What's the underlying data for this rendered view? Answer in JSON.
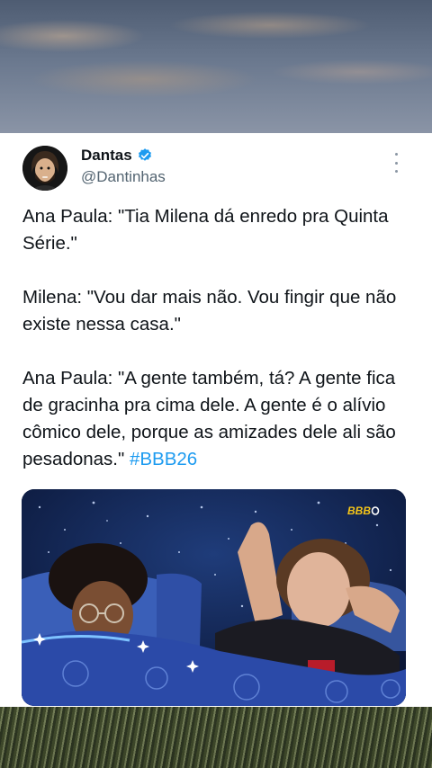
{
  "tweet": {
    "display_name": "Dantas",
    "handle": "@Dantinhas",
    "paragraphs": [
      "Ana Paula: \"Tia Milena dá enredo pra Quinta Série.\"",
      "Milena: \"Vou dar mais não. Vou fingir que não existe nessa casa.\""
    ],
    "last_paragraph_text": "Ana Paula: \"A gente também, tá? A gente fica de gracinha pra cima dele. A gente é o alívio cômico dele, porque as amizades dele ali são pesadonas.\"",
    "hashtag": "#BBB26",
    "media": {
      "watermark": "BBB"
    }
  },
  "colors": {
    "text": "#0f1419",
    "secondary": "#536471",
    "link": "#1d9bf0",
    "verified": "#1d9bf0"
  },
  "icons": [
    "verified-badge-icon",
    "more-options-icon"
  ]
}
